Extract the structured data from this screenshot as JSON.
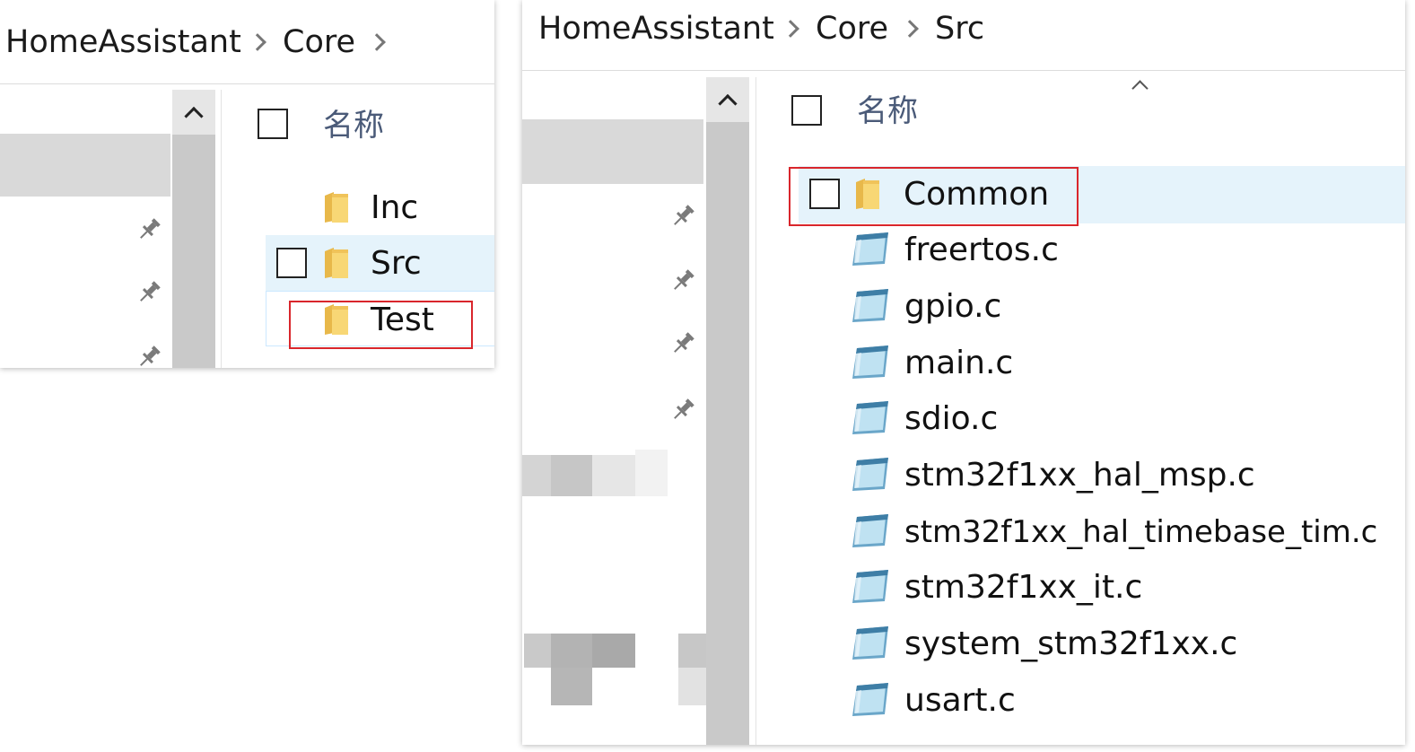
{
  "left_window": {
    "breadcrumb": [
      "HomeAssistant",
      "Core"
    ],
    "column_header": "名称",
    "items": [
      {
        "name": "Inc",
        "type": "folder"
      },
      {
        "name": "Src",
        "type": "folder",
        "state": "hover"
      },
      {
        "name": "Test",
        "type": "folder",
        "state": "focused",
        "highlighted": true
      }
    ]
  },
  "right_window": {
    "breadcrumb": [
      "HomeAssistant",
      "Core",
      "Src"
    ],
    "column_header": "名称",
    "items": [
      {
        "name": "Common",
        "type": "folder",
        "state": "hover",
        "highlighted": true
      },
      {
        "name": "freertos.c",
        "type": "c-file"
      },
      {
        "name": "gpio.c",
        "type": "c-file"
      },
      {
        "name": "main.c",
        "type": "c-file"
      },
      {
        "name": "sdio.c",
        "type": "c-file"
      },
      {
        "name": "stm32f1xx_hal_msp.c",
        "type": "c-file"
      },
      {
        "name": "stm32f1xx_hal_timebase_tim.c",
        "type": "c-file"
      },
      {
        "name": "stm32f1xx_it.c",
        "type": "c-file"
      },
      {
        "name": "system_stm32f1xx.c",
        "type": "c-file"
      },
      {
        "name": "usart.c",
        "type": "c-file"
      }
    ]
  },
  "colors": {
    "hover_row": "#e5f3fb",
    "focus_border": "#cce8ff",
    "highlight_box": "#d9262c",
    "header_text": "#4a5a78",
    "folder": "#f5cf6a"
  }
}
